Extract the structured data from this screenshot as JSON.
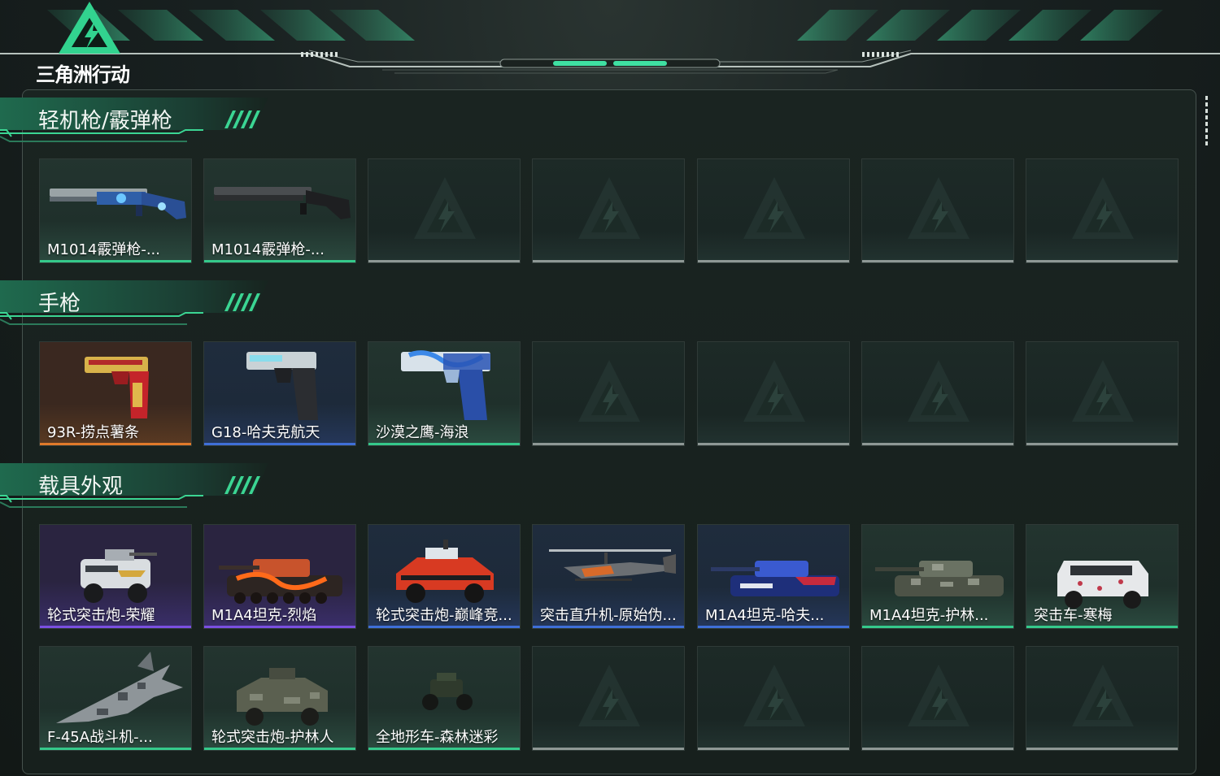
{
  "app": {
    "title": "三角洲行动"
  },
  "colors": {
    "accent": "#35c98b",
    "rarity_green": "#35c98b",
    "rarity_blue": "#3f6fd8",
    "rarity_purple": "#7a4fe0",
    "rarity_orange": "#e07a2b",
    "empty_slot": "#8e9895"
  },
  "sections": [
    {
      "title": "轻机枪/霰弹枪",
      "items": [
        {
          "label": "M1014霰弹枪-...",
          "rarity": "green",
          "icon": "shotgun-blue-camo"
        },
        {
          "label": "M1014霰弹枪-...",
          "rarity": "green",
          "icon": "shotgun-black"
        },
        {
          "label": "",
          "rarity": "empty"
        },
        {
          "label": "",
          "rarity": "empty"
        },
        {
          "label": "",
          "rarity": "empty"
        },
        {
          "label": "",
          "rarity": "empty"
        },
        {
          "label": "",
          "rarity": "empty"
        }
      ]
    },
    {
      "title": "手枪",
      "items": [
        {
          "label": "93R-捞点薯条",
          "rarity": "orange",
          "icon": "pistol-red-gold"
        },
        {
          "label": "G18-哈夫克航天",
          "rarity": "blue",
          "icon": "pistol-glock"
        },
        {
          "label": "沙漠之鹰-海浪",
          "rarity": "green",
          "icon": "pistol-deagle-wave"
        },
        {
          "label": "",
          "rarity": "empty"
        },
        {
          "label": "",
          "rarity": "empty"
        },
        {
          "label": "",
          "rarity": "empty"
        },
        {
          "label": "",
          "rarity": "empty"
        }
      ]
    },
    {
      "title": "载具外观",
      "items": [
        {
          "label": "轮式突击炮-荣耀",
          "rarity": "purple",
          "icon": "armored-car-white"
        },
        {
          "label": "M1A4坦克-烈焰",
          "rarity": "purple",
          "icon": "tank-flame"
        },
        {
          "label": "轮式突击炮-巅峰竞...",
          "rarity": "blue",
          "icon": "armored-car-red"
        },
        {
          "label": "突击直升机-原始伪...",
          "rarity": "blue",
          "icon": "helicopter"
        },
        {
          "label": "M1A4坦克-哈夫...",
          "rarity": "blue",
          "icon": "tank-blue"
        },
        {
          "label": "M1A4坦克-护林...",
          "rarity": "green",
          "icon": "tank-camo"
        },
        {
          "label": "突击车-寒梅",
          "rarity": "green",
          "icon": "assault-car-white"
        },
        {
          "label": "F-45A战斗机-...",
          "rarity": "green",
          "icon": "fighter-jet"
        },
        {
          "label": "轮式突击炮-护林人",
          "rarity": "green",
          "icon": "armored-car-camo"
        },
        {
          "label": "全地形车-森林迷彩",
          "rarity": "green",
          "icon": "atv"
        },
        {
          "label": "",
          "rarity": "empty"
        },
        {
          "label": "",
          "rarity": "empty"
        },
        {
          "label": "",
          "rarity": "empty"
        },
        {
          "label": "",
          "rarity": "empty"
        }
      ]
    }
  ]
}
